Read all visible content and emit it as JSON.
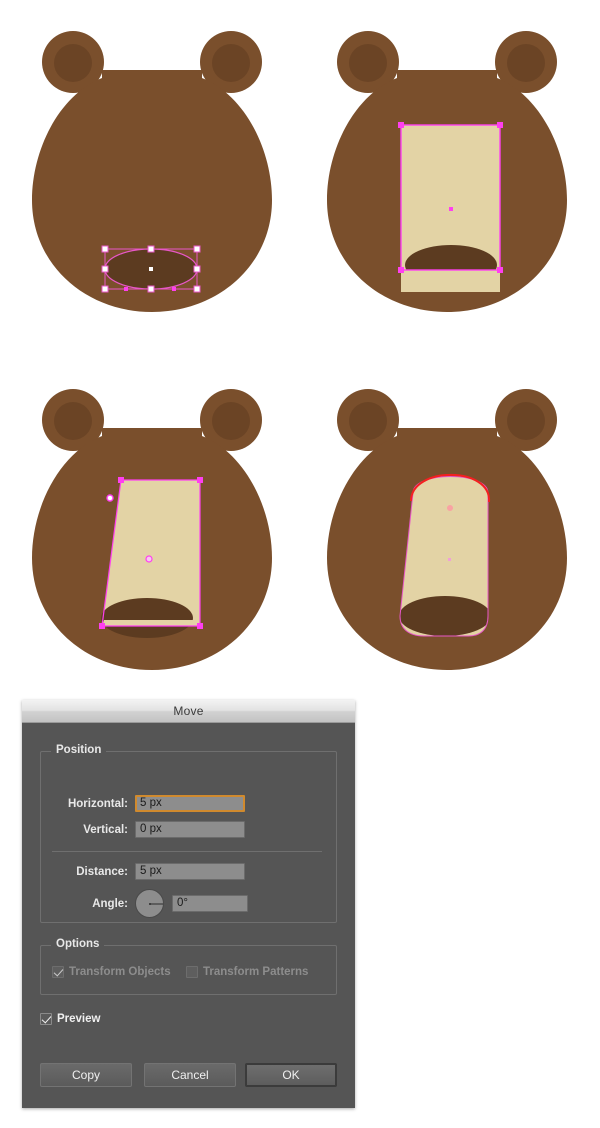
{
  "illustration": {
    "description": "Four-step Adobe Illustrator tutorial showing a bear face being constructed",
    "colors": {
      "head_brown": "#7a4f2c",
      "inner_ear_brown": "#6b4425",
      "muzzle_cream": "#e3d3a5",
      "nose_dark_brown": "#5c3b20",
      "selection_magenta": "#ff3ff0",
      "selection_pink": "#e857c8",
      "anchor_white": "#ffffff",
      "path_highlight_red": "#f42020",
      "background": "#ffffff"
    },
    "steps": [
      {
        "id": "step-1",
        "name": "ellipse-selected-on-head",
        "selected_shape": "ellipse",
        "selection_state": "bounding-box-with-anchor-points"
      },
      {
        "id": "step-2",
        "name": "rectangle-muzzle-selected",
        "selected_shape": "rectangle",
        "selection_state": "bounding-box-with-corner-handles"
      },
      {
        "id": "step-3",
        "name": "skewed-rectangle-muzzle",
        "selected_shape": "quadrilateral",
        "selection_state": "direct-selection-anchors"
      },
      {
        "id": "step-4",
        "name": "rounded-muzzle-with-arc-highlight",
        "selected_shape": "rounded-muzzle",
        "selection_state": "arc-segment-highlighted"
      }
    ]
  },
  "dialog": {
    "title": "Move",
    "position_group": {
      "legend": "Position",
      "fields": [
        {
          "label": "Horizontal:",
          "value": "5 px",
          "focused": true
        },
        {
          "label": "Vertical:",
          "value": "0 px",
          "focused": false
        },
        {
          "label": "Distance:",
          "value": "5 px",
          "focused": false
        },
        {
          "label": "Angle:",
          "value": "0°",
          "focused": false
        }
      ]
    },
    "options_group": {
      "legend": "Options",
      "checkboxes": [
        {
          "label": "Transform Objects",
          "checked": true,
          "enabled": false
        },
        {
          "label": "Transform Patterns",
          "checked": false,
          "enabled": false
        }
      ]
    },
    "preview": {
      "label": "Preview",
      "checked": true,
      "enabled": true
    },
    "buttons": [
      {
        "label": "Copy",
        "default": false
      },
      {
        "label": "Cancel",
        "default": false
      },
      {
        "label": "OK",
        "default": true
      }
    ]
  }
}
